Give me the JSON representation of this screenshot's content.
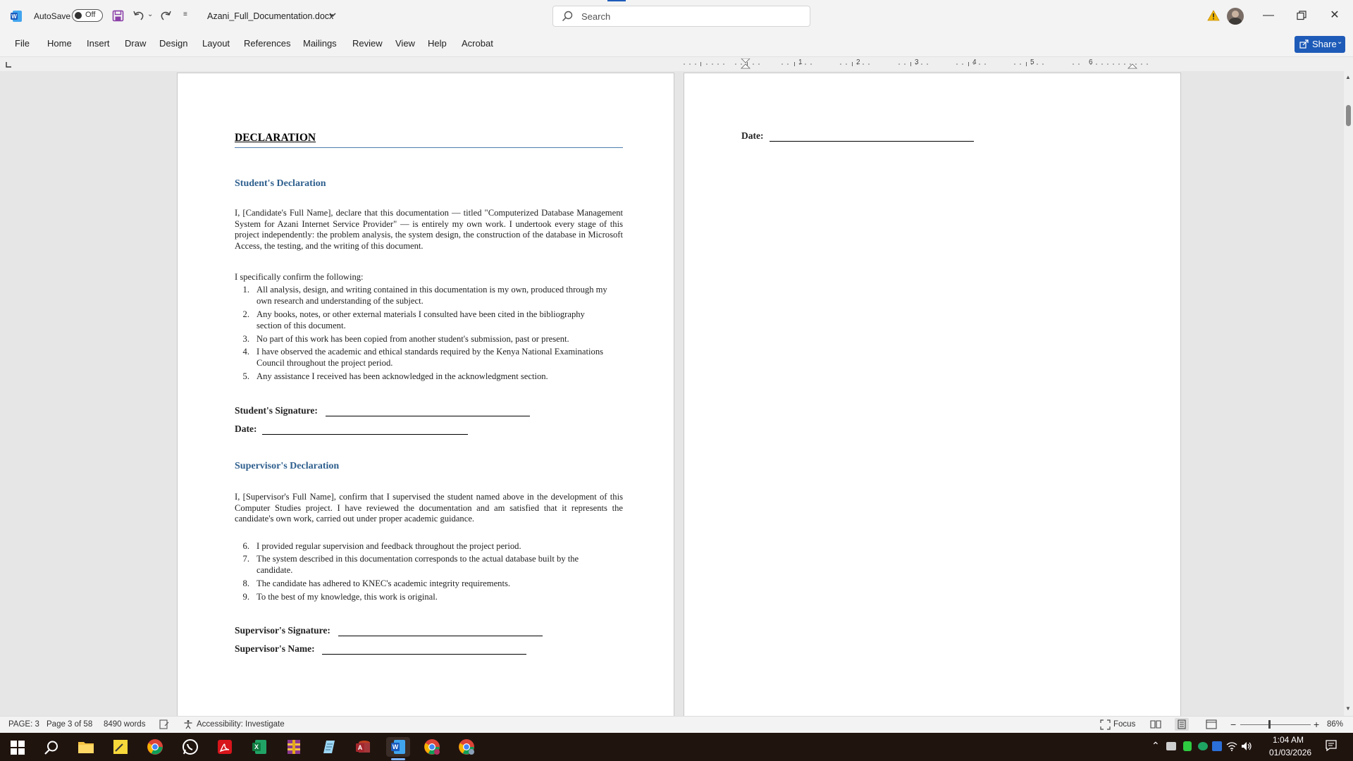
{
  "titlebar": {
    "autosave_label": "AutoSave",
    "autosave_state": "Off",
    "filename": "Azani_Full_Documentation.docx",
    "search_placeholder": "Search"
  },
  "ribbon": {
    "tabs": [
      "File",
      "Home",
      "Insert",
      "Draw",
      "Design",
      "Layout",
      "References",
      "Mailings",
      "Review",
      "View",
      "Help",
      "Acrobat"
    ],
    "share_label": "Share"
  },
  "ruler": {
    "ticks": [
      "1",
      "2",
      "3",
      "4",
      "5",
      "6"
    ]
  },
  "document": {
    "title": "DECLARATION",
    "student_heading": "Student's Declaration",
    "student_para": "I, [Candidate's Full Name], declare that this documentation — titled \"Computerized Database Management System for Azani Internet Service Provider\" — is entirely my own work. I undertook every stage of this project independently: the problem analysis, the system design, the construction of the database in Microsoft Access, the testing, and the writing of this document.",
    "confirm_intro": "I specifically confirm the following:",
    "student_items": [
      {
        "num": "1.",
        "text": "All analysis, design, and writing contained in this documentation is my own, produced through my own research and understanding of the subject."
      },
      {
        "num": "2.",
        "text": "Any books, notes, or other external materials I consulted have been cited in the bibliography section of this document."
      },
      {
        "num": "3.",
        "text": "No part of this work has been copied from another student's submission, past or present."
      },
      {
        "num": "4.",
        "text": "I have observed the academic and ethical standards required by the Kenya National Examinations Council throughout the project period."
      },
      {
        "num": "5.",
        "text": "Any assistance I received has been acknowledged in the acknowledgment section."
      }
    ],
    "student_signature_label": "Student's Signature:",
    "date_label": "Date:",
    "supervisor_heading": "Supervisor's Declaration",
    "supervisor_para": "I, [Supervisor's Full Name], confirm that I supervised the student named above in the development of this Computer Studies project. I have reviewed the documentation and am satisfied that it represents the candidate's own work, carried out under proper academic guidance.",
    "supervisor_items": [
      {
        "num": "6.",
        "text": "I provided regular supervision and feedback throughout the project period."
      },
      {
        "num": "7.",
        "text": "The system described in this documentation corresponds to the actual database built by the candidate."
      },
      {
        "num": "8.",
        "text": "The candidate has adhered to KNEC's academic integrity requirements."
      },
      {
        "num": "9.",
        "text": "To the best of my knowledge, this work is original."
      }
    ],
    "supervisor_signature_label": "Supervisor's Signature:",
    "supervisor_name_label": "Supervisor's Name:",
    "page2_date_label": "Date:"
  },
  "statusbar": {
    "page_section": "PAGE: 3",
    "page_count": "Page 3 of 58",
    "word_count": "8490 words",
    "accessibility": "Accessibility: Investigate",
    "focus_label": "Focus",
    "zoom_out": "−",
    "zoom_in": "+",
    "zoom_level": "86%"
  },
  "taskbar": {
    "time": "1:04 AM",
    "date": "01/03/2026"
  },
  "colors": {
    "accent": "#1e5bb8",
    "heading_blue": "#2e5f8e",
    "taskbar_bg": "#20140f"
  }
}
